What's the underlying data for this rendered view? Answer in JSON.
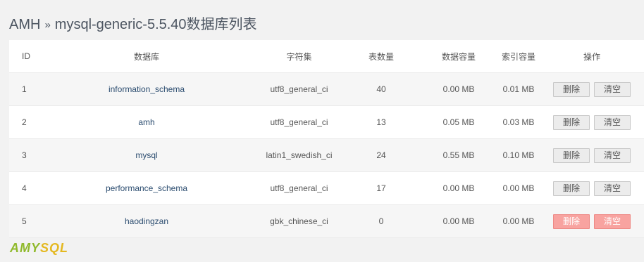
{
  "page": {
    "breadcrumb_root": "AMH",
    "breadcrumb_sep": "»",
    "breadcrumb_title": "mysql-generic-5.5.40数据库列表"
  },
  "table": {
    "columns": [
      "ID",
      "数据库",
      "字符集",
      "表数量",
      "数据容量",
      "索引容量",
      "操作"
    ],
    "rows": [
      {
        "id": "1",
        "name": "information_schema",
        "charset": "utf8_general_ci",
        "tables": "40",
        "data_size": "0.00 MB",
        "index_size": "0.01 MB",
        "delete": "删除",
        "clear": "清空"
      },
      {
        "id": "2",
        "name": "amh",
        "charset": "utf8_general_ci",
        "tables": "13",
        "data_size": "0.05 MB",
        "index_size": "0.03 MB",
        "delete": "删除",
        "clear": "清空"
      },
      {
        "id": "3",
        "name": "mysql",
        "charset": "latin1_swedish_ci",
        "tables": "24",
        "data_size": "0.55 MB",
        "index_size": "0.10 MB",
        "delete": "删除",
        "clear": "清空"
      },
      {
        "id": "4",
        "name": "performance_schema",
        "charset": "utf8_general_ci",
        "tables": "17",
        "data_size": "0.00 MB",
        "index_size": "0.00 MB",
        "delete": "删除",
        "clear": "清空"
      },
      {
        "id": "5",
        "name": "haodingzan",
        "charset": "gbk_chinese_ci",
        "tables": "0",
        "data_size": "0.00 MB",
        "index_size": "0.00 MB",
        "delete": "删除",
        "clear": "清空"
      }
    ]
  },
  "logo": {
    "part1": "AMY",
    "part2": "SQL"
  },
  "colors": {
    "danger": "#f8a3a0",
    "link": "#2b4c6f",
    "logo_green": "#8fb92b",
    "logo_yellow": "#e4b820"
  }
}
